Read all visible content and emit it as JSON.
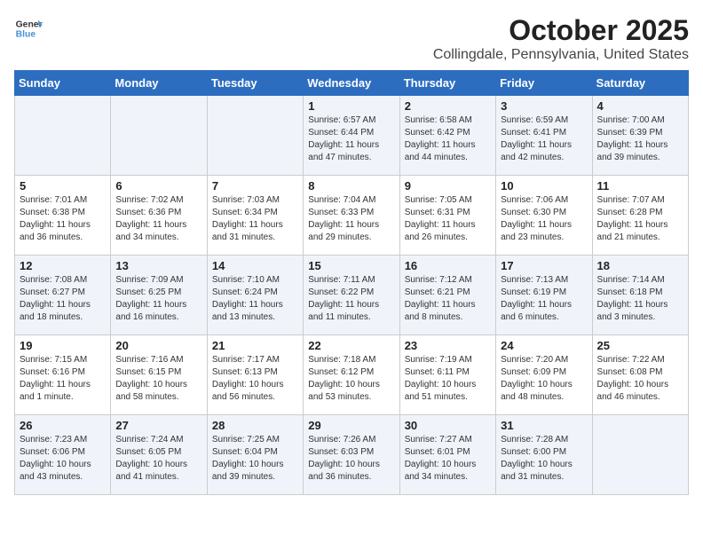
{
  "header": {
    "logo_line1": "General",
    "logo_line2": "Blue",
    "title": "October 2025",
    "subtitle": "Collingdale, Pennsylvania, United States"
  },
  "columns": [
    "Sunday",
    "Monday",
    "Tuesday",
    "Wednesday",
    "Thursday",
    "Friday",
    "Saturday"
  ],
  "weeks": [
    [
      {
        "day": "",
        "info": ""
      },
      {
        "day": "",
        "info": ""
      },
      {
        "day": "",
        "info": ""
      },
      {
        "day": "1",
        "info": "Sunrise: 6:57 AM\nSunset: 6:44 PM\nDaylight: 11 hours\nand 47 minutes."
      },
      {
        "day": "2",
        "info": "Sunrise: 6:58 AM\nSunset: 6:42 PM\nDaylight: 11 hours\nand 44 minutes."
      },
      {
        "day": "3",
        "info": "Sunrise: 6:59 AM\nSunset: 6:41 PM\nDaylight: 11 hours\nand 42 minutes."
      },
      {
        "day": "4",
        "info": "Sunrise: 7:00 AM\nSunset: 6:39 PM\nDaylight: 11 hours\nand 39 minutes."
      }
    ],
    [
      {
        "day": "5",
        "info": "Sunrise: 7:01 AM\nSunset: 6:38 PM\nDaylight: 11 hours\nand 36 minutes."
      },
      {
        "day": "6",
        "info": "Sunrise: 7:02 AM\nSunset: 6:36 PM\nDaylight: 11 hours\nand 34 minutes."
      },
      {
        "day": "7",
        "info": "Sunrise: 7:03 AM\nSunset: 6:34 PM\nDaylight: 11 hours\nand 31 minutes."
      },
      {
        "day": "8",
        "info": "Sunrise: 7:04 AM\nSunset: 6:33 PM\nDaylight: 11 hours\nand 29 minutes."
      },
      {
        "day": "9",
        "info": "Sunrise: 7:05 AM\nSunset: 6:31 PM\nDaylight: 11 hours\nand 26 minutes."
      },
      {
        "day": "10",
        "info": "Sunrise: 7:06 AM\nSunset: 6:30 PM\nDaylight: 11 hours\nand 23 minutes."
      },
      {
        "day": "11",
        "info": "Sunrise: 7:07 AM\nSunset: 6:28 PM\nDaylight: 11 hours\nand 21 minutes."
      }
    ],
    [
      {
        "day": "12",
        "info": "Sunrise: 7:08 AM\nSunset: 6:27 PM\nDaylight: 11 hours\nand 18 minutes."
      },
      {
        "day": "13",
        "info": "Sunrise: 7:09 AM\nSunset: 6:25 PM\nDaylight: 11 hours\nand 16 minutes."
      },
      {
        "day": "14",
        "info": "Sunrise: 7:10 AM\nSunset: 6:24 PM\nDaylight: 11 hours\nand 13 minutes."
      },
      {
        "day": "15",
        "info": "Sunrise: 7:11 AM\nSunset: 6:22 PM\nDaylight: 11 hours\nand 11 minutes."
      },
      {
        "day": "16",
        "info": "Sunrise: 7:12 AM\nSunset: 6:21 PM\nDaylight: 11 hours\nand 8 minutes."
      },
      {
        "day": "17",
        "info": "Sunrise: 7:13 AM\nSunset: 6:19 PM\nDaylight: 11 hours\nand 6 minutes."
      },
      {
        "day": "18",
        "info": "Sunrise: 7:14 AM\nSunset: 6:18 PM\nDaylight: 11 hours\nand 3 minutes."
      }
    ],
    [
      {
        "day": "19",
        "info": "Sunrise: 7:15 AM\nSunset: 6:16 PM\nDaylight: 11 hours\nand 1 minute."
      },
      {
        "day": "20",
        "info": "Sunrise: 7:16 AM\nSunset: 6:15 PM\nDaylight: 10 hours\nand 58 minutes."
      },
      {
        "day": "21",
        "info": "Sunrise: 7:17 AM\nSunset: 6:13 PM\nDaylight: 10 hours\nand 56 minutes."
      },
      {
        "day": "22",
        "info": "Sunrise: 7:18 AM\nSunset: 6:12 PM\nDaylight: 10 hours\nand 53 minutes."
      },
      {
        "day": "23",
        "info": "Sunrise: 7:19 AM\nSunset: 6:11 PM\nDaylight: 10 hours\nand 51 minutes."
      },
      {
        "day": "24",
        "info": "Sunrise: 7:20 AM\nSunset: 6:09 PM\nDaylight: 10 hours\nand 48 minutes."
      },
      {
        "day": "25",
        "info": "Sunrise: 7:22 AM\nSunset: 6:08 PM\nDaylight: 10 hours\nand 46 minutes."
      }
    ],
    [
      {
        "day": "26",
        "info": "Sunrise: 7:23 AM\nSunset: 6:06 PM\nDaylight: 10 hours\nand 43 minutes."
      },
      {
        "day": "27",
        "info": "Sunrise: 7:24 AM\nSunset: 6:05 PM\nDaylight: 10 hours\nand 41 minutes."
      },
      {
        "day": "28",
        "info": "Sunrise: 7:25 AM\nSunset: 6:04 PM\nDaylight: 10 hours\nand 39 minutes."
      },
      {
        "day": "29",
        "info": "Sunrise: 7:26 AM\nSunset: 6:03 PM\nDaylight: 10 hours\nand 36 minutes."
      },
      {
        "day": "30",
        "info": "Sunrise: 7:27 AM\nSunset: 6:01 PM\nDaylight: 10 hours\nand 34 minutes."
      },
      {
        "day": "31",
        "info": "Sunrise: 7:28 AM\nSunset: 6:00 PM\nDaylight: 10 hours\nand 31 minutes."
      },
      {
        "day": "",
        "info": ""
      }
    ]
  ]
}
